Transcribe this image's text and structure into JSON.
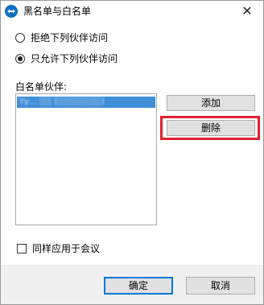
{
  "window": {
    "title": "黑名单与白名单",
    "close_symbol": "✕"
  },
  "access": {
    "options": [
      {
        "label": "拒绝下列伙伴访问",
        "checked": false
      },
      {
        "label": "只允许下列伙伴访问",
        "checked": true
      }
    ]
  },
  "whitelist": {
    "label": "白名单伙伴:",
    "items": [
      {
        "text": "Yy… ░░ [░░░░░░░]",
        "selected": true
      }
    ]
  },
  "buttons": {
    "add": "添加",
    "delete": "删除",
    "ok": "确定",
    "cancel": "取消"
  },
  "meeting_option": {
    "label": "同样应用于会议",
    "checked": false
  },
  "colors": {
    "accent": "#0078d7",
    "selection": "#3f8ed8",
    "highlight_box": "#e0212b"
  },
  "icons": {
    "app": "teamviewer-icon",
    "close": "close-icon"
  }
}
